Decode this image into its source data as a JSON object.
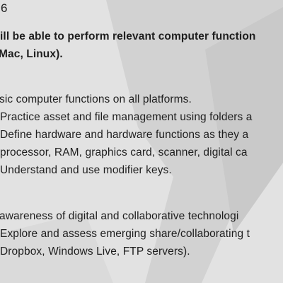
{
  "document": {
    "header_number": "6",
    "objective": {
      "line1": "ill be able to perform relevant computer function",
      "line2": "Mac, Linux)."
    },
    "section1": {
      "heading": "sic computer functions on all platforms.",
      "items": [
        "Practice asset and file management using folders a",
        "Define hardware and hardware functions as they a",
        "processor, RAM, graphics card, scanner, digital ca",
        "Understand and use modifier keys."
      ]
    },
    "section2": {
      "heading": "awareness of digital and collaborative technologi",
      "items": [
        "Explore and assess emerging share/collaborating t",
        "Dropbox, Windows Live, FTP servers)."
      ]
    }
  }
}
